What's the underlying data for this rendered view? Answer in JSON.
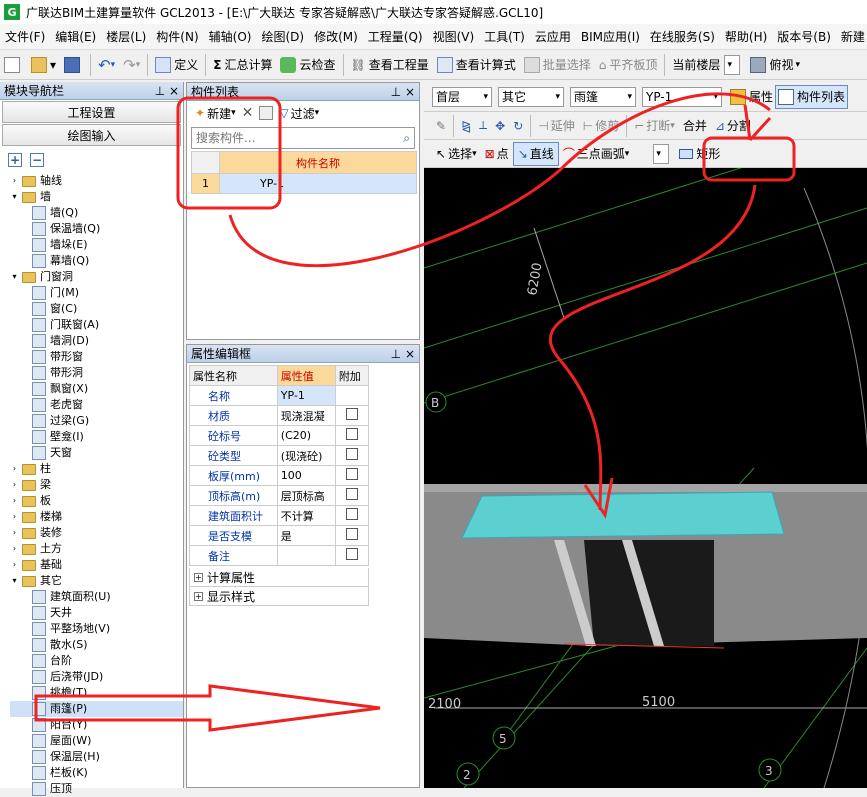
{
  "title_bar": {
    "logo": "G",
    "text": "广联达BIM土建算量软件 GCL2013 - [E:\\广大联达  专家答疑解惑\\广大联达专家答疑解惑.GCL10]"
  },
  "menu": [
    "文件(F)",
    "编辑(E)",
    "楼层(L)",
    "构件(N)",
    "辅轴(O)",
    "绘图(D)",
    "修改(M)",
    "工程量(Q)",
    "视图(V)",
    "工具(T)",
    "云应用",
    "BIM应用(I)",
    "在线服务(S)",
    "帮助(H)",
    "版本号(B)",
    "新建"
  ],
  "toolbar1": {
    "define": "定义",
    "sum": "汇总计算",
    "cloud_check": "云检查",
    "view_quantity": "查看工程量",
    "view_formula": "查看计算式",
    "batch_select": "批量选择",
    "flat_plate": "平齐板顶",
    "floor_label": "当前楼层",
    "view_label": "俯视"
  },
  "nav": {
    "title": "模块导航栏",
    "btn_project": "工程设置",
    "btn_draw": "绘图输入",
    "tree": [
      {
        "t": "f",
        "d": 0,
        "open": false,
        "label": "轴线"
      },
      {
        "t": "f",
        "d": 0,
        "open": true,
        "label": "墙"
      },
      {
        "t": "l",
        "d": 1,
        "label": "墙(Q)"
      },
      {
        "t": "l",
        "d": 1,
        "label": "保温墙(Q)"
      },
      {
        "t": "l",
        "d": 1,
        "label": "墙垛(E)"
      },
      {
        "t": "l",
        "d": 1,
        "label": "幕墙(Q)"
      },
      {
        "t": "f",
        "d": 0,
        "open": true,
        "label": "门窗洞"
      },
      {
        "t": "l",
        "d": 1,
        "label": "门(M)"
      },
      {
        "t": "l",
        "d": 1,
        "label": "窗(C)"
      },
      {
        "t": "l",
        "d": 1,
        "label": "门联窗(A)"
      },
      {
        "t": "l",
        "d": 1,
        "label": "墙洞(D)"
      },
      {
        "t": "l",
        "d": 1,
        "label": "带形窗"
      },
      {
        "t": "l",
        "d": 1,
        "label": "带形洞"
      },
      {
        "t": "l",
        "d": 1,
        "label": "飘窗(X)"
      },
      {
        "t": "l",
        "d": 1,
        "label": "老虎窗"
      },
      {
        "t": "l",
        "d": 1,
        "label": "过梁(G)"
      },
      {
        "t": "l",
        "d": 1,
        "label": "壁龛(I)"
      },
      {
        "t": "l",
        "d": 1,
        "label": "天窗"
      },
      {
        "t": "f",
        "d": 0,
        "open": false,
        "label": "柱"
      },
      {
        "t": "f",
        "d": 0,
        "open": false,
        "label": "梁"
      },
      {
        "t": "f",
        "d": 0,
        "open": false,
        "label": "板"
      },
      {
        "t": "f",
        "d": 0,
        "open": false,
        "label": "楼梯"
      },
      {
        "t": "f",
        "d": 0,
        "open": false,
        "label": "装修"
      },
      {
        "t": "f",
        "d": 0,
        "open": false,
        "label": "土方"
      },
      {
        "t": "f",
        "d": 0,
        "open": false,
        "label": "基础"
      },
      {
        "t": "f",
        "d": 0,
        "open": true,
        "label": "其它"
      },
      {
        "t": "l",
        "d": 1,
        "label": "建筑面积(U)"
      },
      {
        "t": "l",
        "d": 1,
        "label": "天井"
      },
      {
        "t": "l",
        "d": 1,
        "label": "平整场地(V)"
      },
      {
        "t": "l",
        "d": 1,
        "label": "散水(S)"
      },
      {
        "t": "l",
        "d": 1,
        "label": "台阶"
      },
      {
        "t": "l",
        "d": 1,
        "label": "后浇带(JD)"
      },
      {
        "t": "l",
        "d": 1,
        "label": "挑檐(T)"
      },
      {
        "t": "l",
        "d": 1,
        "label": "雨篷(P)",
        "sel": true
      },
      {
        "t": "l",
        "d": 1,
        "label": "阳台(Y)"
      },
      {
        "t": "l",
        "d": 1,
        "label": "屋面(W)"
      },
      {
        "t": "l",
        "d": 1,
        "label": "保温层(H)"
      },
      {
        "t": "l",
        "d": 1,
        "label": "栏板(K)"
      },
      {
        "t": "l",
        "d": 1,
        "label": "压顶"
      }
    ]
  },
  "component_list": {
    "title": "构件列表",
    "new": "新建",
    "filter": "过滤",
    "search_placeholder": "搜索构件...",
    "col_header": "构件名称",
    "rows": [
      {
        "no": "1",
        "name": "YP-1"
      }
    ]
  },
  "prop_editor": {
    "title": "属性编辑框",
    "headers": [
      "属性名称",
      "属性值",
      "附加"
    ],
    "rows": [
      {
        "k": "名称",
        "v": "YP-1",
        "cb": false
      },
      {
        "k": "材质",
        "v": "现浇混凝",
        "cb": true
      },
      {
        "k": "砼标号",
        "v": "(C20)",
        "cb": true
      },
      {
        "k": "砼类型",
        "v": "(现浇砼)",
        "cb": true
      },
      {
        "k": "板厚(mm)",
        "v": "100",
        "cb": true
      },
      {
        "k": "顶标高(m)",
        "v": "层顶标高",
        "cb": true
      },
      {
        "k": "建筑面积计",
        "v": "不计算",
        "cb": true
      },
      {
        "k": "是否支模",
        "v": "是",
        "cb": true
      },
      {
        "k": "备注",
        "v": "",
        "cb": true
      }
    ],
    "group1": "计算属性",
    "group2": "显示样式"
  },
  "toolbar2": {
    "floor": "首层",
    "type": "其它",
    "comp": "雨篷",
    "name": "YP-1",
    "attr": "属性",
    "list": "构件列表"
  },
  "toolbar3": {
    "extend": "延伸",
    "trim": "修剪",
    "break": "打断",
    "merge": "合并",
    "split": "分割"
  },
  "toolbar4": {
    "select": "选择",
    "point": "点",
    "line": "直线",
    "arc": "三点画弧",
    "rect": "矩形"
  },
  "viewport": {
    "dim_vertical": "6200",
    "dim_2100": "2100",
    "dim_5100": "5100",
    "axis_B": "B",
    "axis_5": "5",
    "axis_2": "2",
    "axis_3": "3"
  }
}
